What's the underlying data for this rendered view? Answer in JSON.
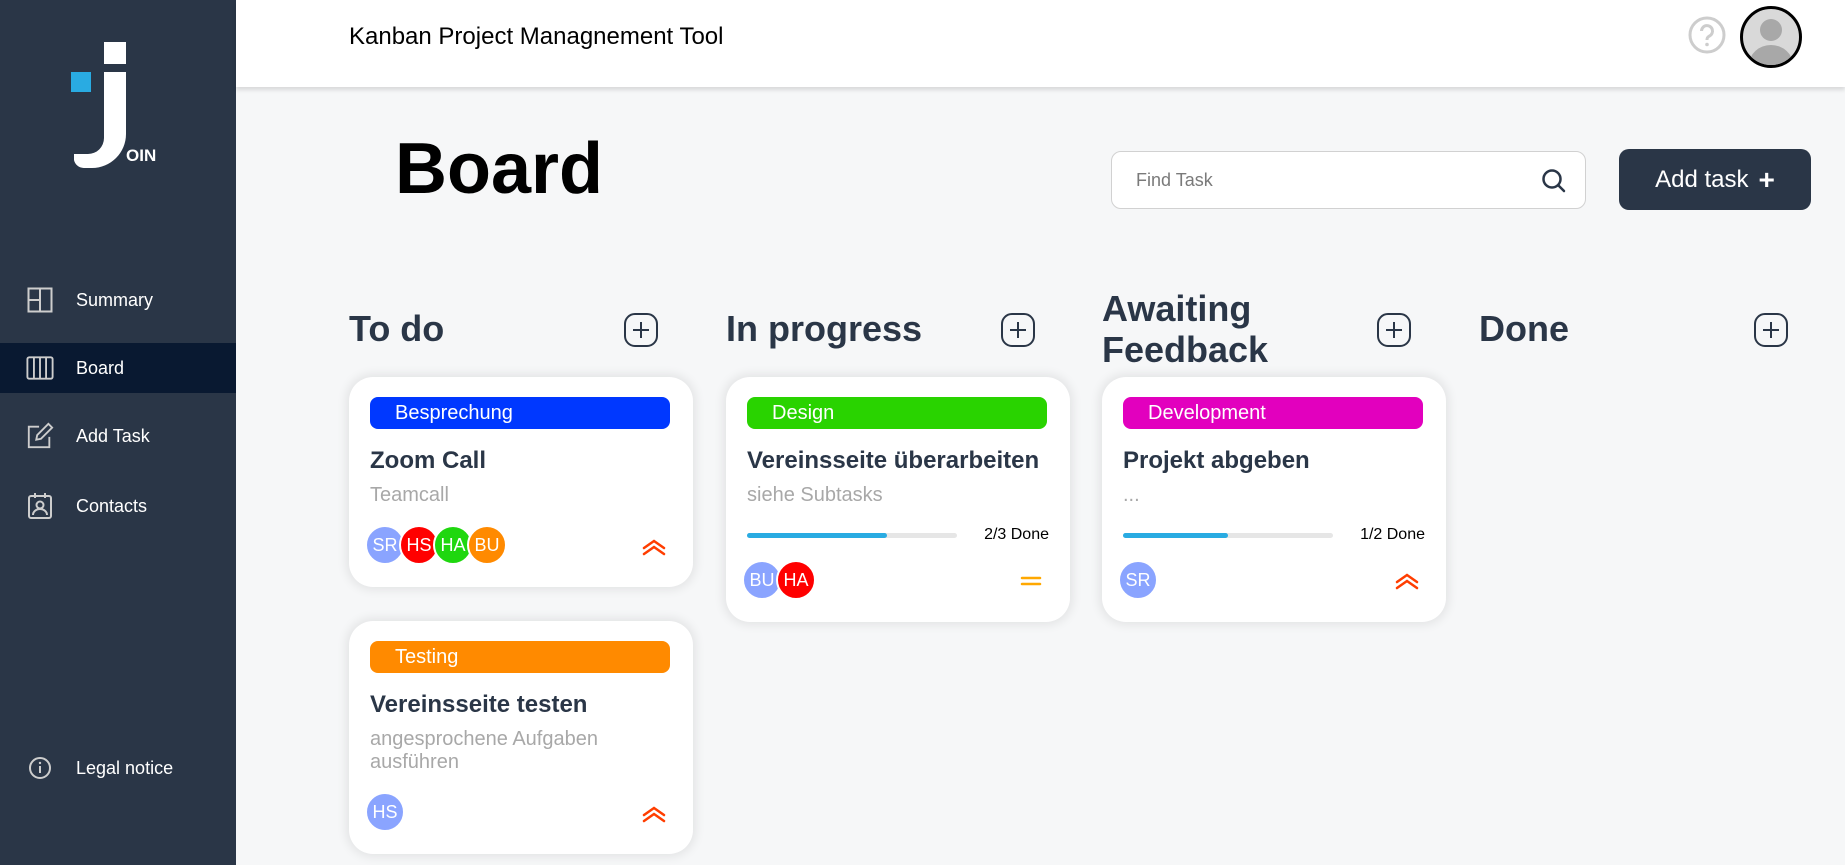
{
  "app": {
    "header_title": "Kanban Project Managnement Tool",
    "logo_letters": "OIN"
  },
  "sidebar": {
    "items": [
      {
        "label": "Summary",
        "icon": "summary-icon"
      },
      {
        "label": "Board",
        "icon": "board-icon",
        "active": true
      },
      {
        "label": "Add Task",
        "icon": "add-task-icon"
      },
      {
        "label": "Contacts",
        "icon": "contacts-icon"
      }
    ],
    "legal_label": "Legal notice"
  },
  "board": {
    "title": "Board",
    "search_placeholder": "Find Task",
    "add_task_label": "Add task",
    "add_task_plus": "+"
  },
  "columns": [
    {
      "title": "To do"
    },
    {
      "title_line1": "In progress"
    },
    {
      "title_line1": "Awaiting",
      "title_line2": "Feedback"
    },
    {
      "title": "Done"
    }
  ],
  "cards": [
    {
      "column": "To do",
      "category": "Besprechung",
      "category_color": "#0038ff",
      "title": "Zoom Call",
      "description": "Teamcall",
      "assignees": [
        {
          "initials": "SR",
          "color": "#8aa4ff"
        },
        {
          "initials": "HS",
          "color": "#ff0000"
        },
        {
          "initials": "HA",
          "color": "#1fd70f"
        },
        {
          "initials": "BU",
          "color": "#ff8a00"
        }
      ],
      "priority": "urgent"
    },
    {
      "column": "To do",
      "category": "Testing",
      "category_color": "#ff8a00",
      "title": "Vereinsseite testen",
      "description": "angesprochene Aufgaben ausführen",
      "assignees": [
        {
          "initials": "HS",
          "color": "#8aa4ff"
        }
      ],
      "priority": "urgent"
    },
    {
      "column": "In progress",
      "category": "Design",
      "category_color": "#29d300",
      "title": "Vereinsseite überarbeiten",
      "description": "siehe Subtasks",
      "progress": 0.6667,
      "progress_text": "2/3 Done",
      "assignees": [
        {
          "initials": "BU",
          "color": "#8aa4ff"
        },
        {
          "initials": "HA",
          "color": "#ff0000"
        }
      ],
      "priority": "medium"
    },
    {
      "column": "Awaiting Feedback",
      "category": "Development",
      "category_color": "#e200be",
      "title": "Projekt abgeben",
      "description": "...",
      "progress": 0.5,
      "progress_text": "1/2 Done",
      "assignees": [
        {
          "initials": "SR",
          "color": "#8aa4ff"
        }
      ],
      "priority": "urgent"
    }
  ],
  "colors": {
    "sidebar": "#2a3647",
    "active_nav": "#091931",
    "accent": "#29abe2",
    "urgent": "#ff3d00",
    "medium": "#ffa800"
  }
}
